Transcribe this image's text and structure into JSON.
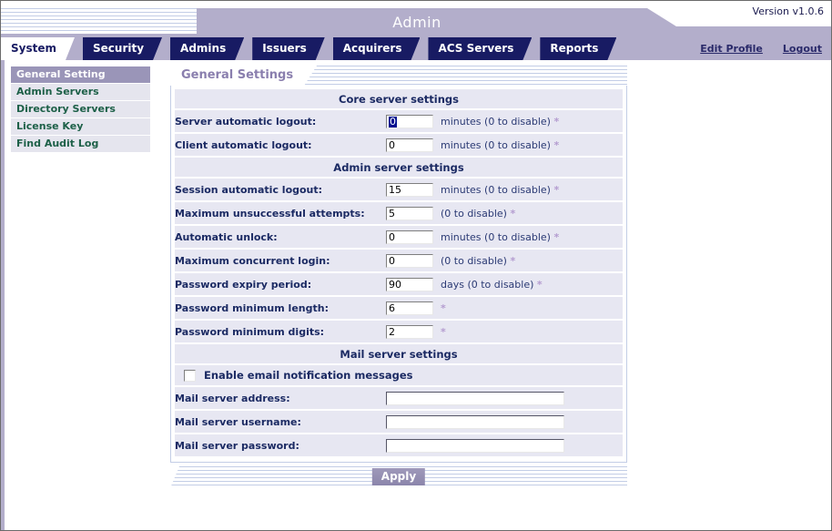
{
  "header": {
    "title": "Admin",
    "version": "Version v1.0.6",
    "links": [
      {
        "label": "Edit Profile",
        "name": "edit-profile-link"
      },
      {
        "label": "Logout",
        "name": "logout-link"
      }
    ]
  },
  "tabs": [
    {
      "label": "System",
      "active": true
    },
    {
      "label": "Security",
      "active": false
    },
    {
      "label": "Admins",
      "active": false
    },
    {
      "label": "Issuers",
      "active": false
    },
    {
      "label": "Acquirers",
      "active": false
    },
    {
      "label": "ACS Servers",
      "active": false
    },
    {
      "label": "Reports",
      "active": false
    }
  ],
  "sidebar": {
    "items": [
      {
        "label": "General Setting",
        "active": true
      },
      {
        "label": "Admin Servers",
        "active": false
      },
      {
        "label": "Directory Servers",
        "active": false
      },
      {
        "label": "License Key",
        "active": false
      },
      {
        "label": "Find Audit Log",
        "active": false
      }
    ]
  },
  "panel": {
    "title": "General Settings",
    "sections": [
      {
        "heading": "Core server settings",
        "rows": [
          {
            "label": "Server automatic logout:",
            "value": "0",
            "unit": "minutes (0 to disable)",
            "required": true,
            "focused": true
          },
          {
            "label": "Client automatic logout:",
            "value": "0",
            "unit": "minutes (0 to disable)",
            "required": true,
            "focused": false
          }
        ]
      },
      {
        "heading": "Admin server settings",
        "rows": [
          {
            "label": "Session automatic logout:",
            "value": "15",
            "unit": "minutes (0 to disable)",
            "required": true,
            "focused": false
          },
          {
            "label": "Maximum unsuccessful attempts:",
            "value": "5",
            "unit": "(0 to disable)",
            "required": true,
            "focused": false
          },
          {
            "label": "Automatic unlock:",
            "value": "0",
            "unit": "minutes (0 to disable)",
            "required": true,
            "focused": false
          },
          {
            "label": "Maximum concurrent login:",
            "value": "0",
            "unit": "(0 to disable)",
            "required": true,
            "focused": false
          },
          {
            "label": "Password expiry period:",
            "value": "90",
            "unit": "days (0 to disable)",
            "required": true,
            "focused": false
          },
          {
            "label": "Password minimum length:",
            "value": "6",
            "unit": "",
            "required": true,
            "focused": false
          },
          {
            "label": "Password minimum digits:",
            "value": "2",
            "unit": "",
            "required": true,
            "focused": false
          }
        ]
      }
    ],
    "mail": {
      "heading": "Mail server settings",
      "checkbox": {
        "label": "Enable email notification messages",
        "checked": false
      },
      "rows": [
        {
          "label": "Mail server address:",
          "value": ""
        },
        {
          "label": "Mail server username:",
          "value": ""
        },
        {
          "label": "Mail server password:",
          "value": ""
        }
      ]
    },
    "apply_label": "Apply"
  },
  "colors": {
    "tab_active_bg": "#ffffff",
    "tab_inactive_bg": "#181b63",
    "banner": "#b3aecb",
    "panel_title": "#8a7fae",
    "row_bg": "#e7e7f2",
    "required_star": "#b49cd0",
    "sidebar_active_bg": "#9a95b8",
    "sidebar_text": "#1d6048"
  },
  "required_marker": "*"
}
